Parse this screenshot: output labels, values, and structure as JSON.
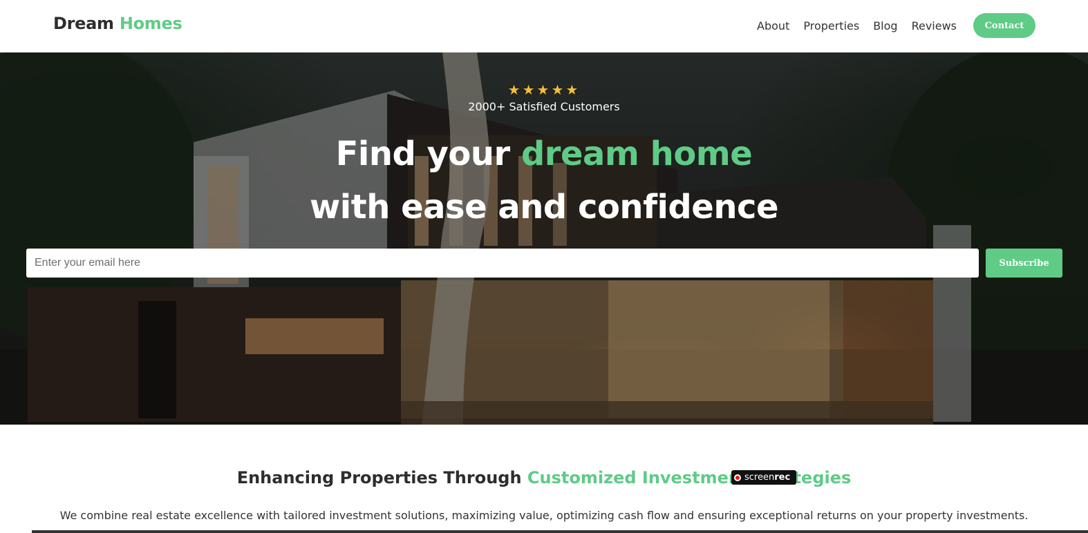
{
  "nav": {
    "logo_part1": "Dream",
    "logo_part2": "Homes",
    "links": [
      "About",
      "Properties",
      "Blog",
      "Reviews"
    ],
    "contact_label": "Contact"
  },
  "hero": {
    "rating_stars": "★★★★★",
    "customers_text": "2000+ Satisfied Customers",
    "headline_part1": "Find your ",
    "headline_highlight": "dream home",
    "headline_line2": "with ease and confidence",
    "email_placeholder": "Enter your email here",
    "subscribe_label": "Subscribe"
  },
  "section": {
    "title_part1": "Enhancing Properties Through ",
    "title_highlight": "Customized Investment Strategies",
    "description": "We combine real estate excellence with tailored investment solutions, maximizing value, optimizing cash flow and ensuring exceptional returns on your property investments."
  },
  "overlay": {
    "recorder_label_1": "screen",
    "recorder_label_2": "rec"
  },
  "colors": {
    "accent": "#5fcb86",
    "star": "#f5bf3a",
    "text": "#2d2d2d"
  }
}
